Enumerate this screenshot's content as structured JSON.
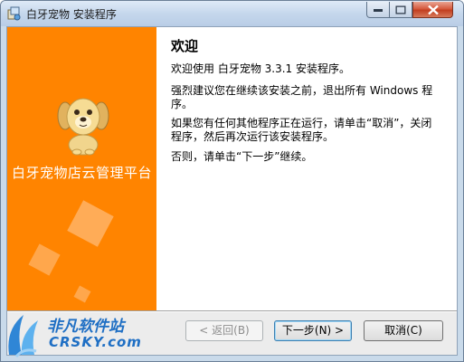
{
  "window": {
    "title": "白牙宠物 安装程序"
  },
  "side_panel": {
    "brand_text": "白牙宠物店云管理平台",
    "accent_color": "#ff8400"
  },
  "content": {
    "heading": "欢迎",
    "paragraphs": [
      "欢迎使用 白牙宠物 3.3.1 安装程序。",
      "强烈建议您在继续该安装之前，退出所有 Windows 程序。",
      "如果您有任何其他程序正在运行，请单击“取消”，关闭程序，然后再次运行该安装程序。",
      "否则，请单击“下一步”继续。"
    ]
  },
  "buttons": {
    "back": "< 返回(B)",
    "next": "下一步(N) >",
    "cancel": "取消(C)"
  },
  "watermark": {
    "name_cn": "非凡软件站",
    "name_en": "CRSKY.com"
  }
}
